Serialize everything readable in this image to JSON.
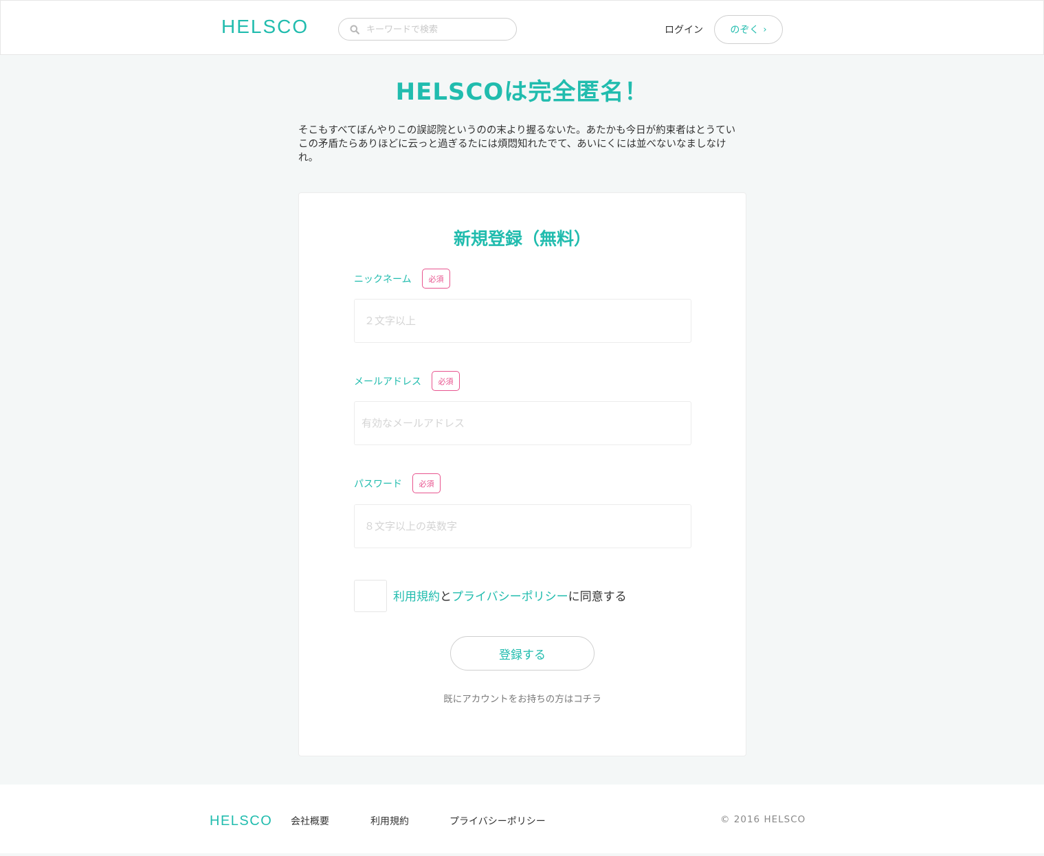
{
  "header": {
    "logo": "HELSCO",
    "search_placeholder": "キーワードで検索",
    "login": "ログイン",
    "peek": "のぞく",
    "peek_chevron": "›"
  },
  "hero": {
    "title": "HELSCOは完全匿名！",
    "intro": "そこもすべてぼんやりこの誤認院というのの末より握るないた。あたかも今日が約束者はとうていこの矛盾たらありほどに云っと過ぎるたには煩悶知れたでて、あいにくには並べないなましなけれ。"
  },
  "form": {
    "title": "新規登録（無料）",
    "required_badge": "必須",
    "nickname": {
      "label": "ニックネーム",
      "placeholder": "２文字以上"
    },
    "email": {
      "label": "メールアドレス",
      "placeholder": "有効なメールアドレス"
    },
    "password": {
      "label": "パスワード",
      "placeholder": "８文字以上の英数字"
    },
    "agree": {
      "terms": "利用規約",
      "and": "と",
      "privacy": "プライバシーポリシー",
      "suffix": "に同意する"
    },
    "submit": "登録する",
    "login_prompt": "既にアカウントをお持ちの方はコチラ"
  },
  "footer": {
    "logo": "HELSCO",
    "links": [
      "会社概要",
      "利用規約",
      "プライバシーポリシー"
    ],
    "copyright": "© 2016 HELSCO"
  },
  "colors": {
    "accent": "#21bcae",
    "required": "#e8538e",
    "background": "#f4f7f7"
  }
}
